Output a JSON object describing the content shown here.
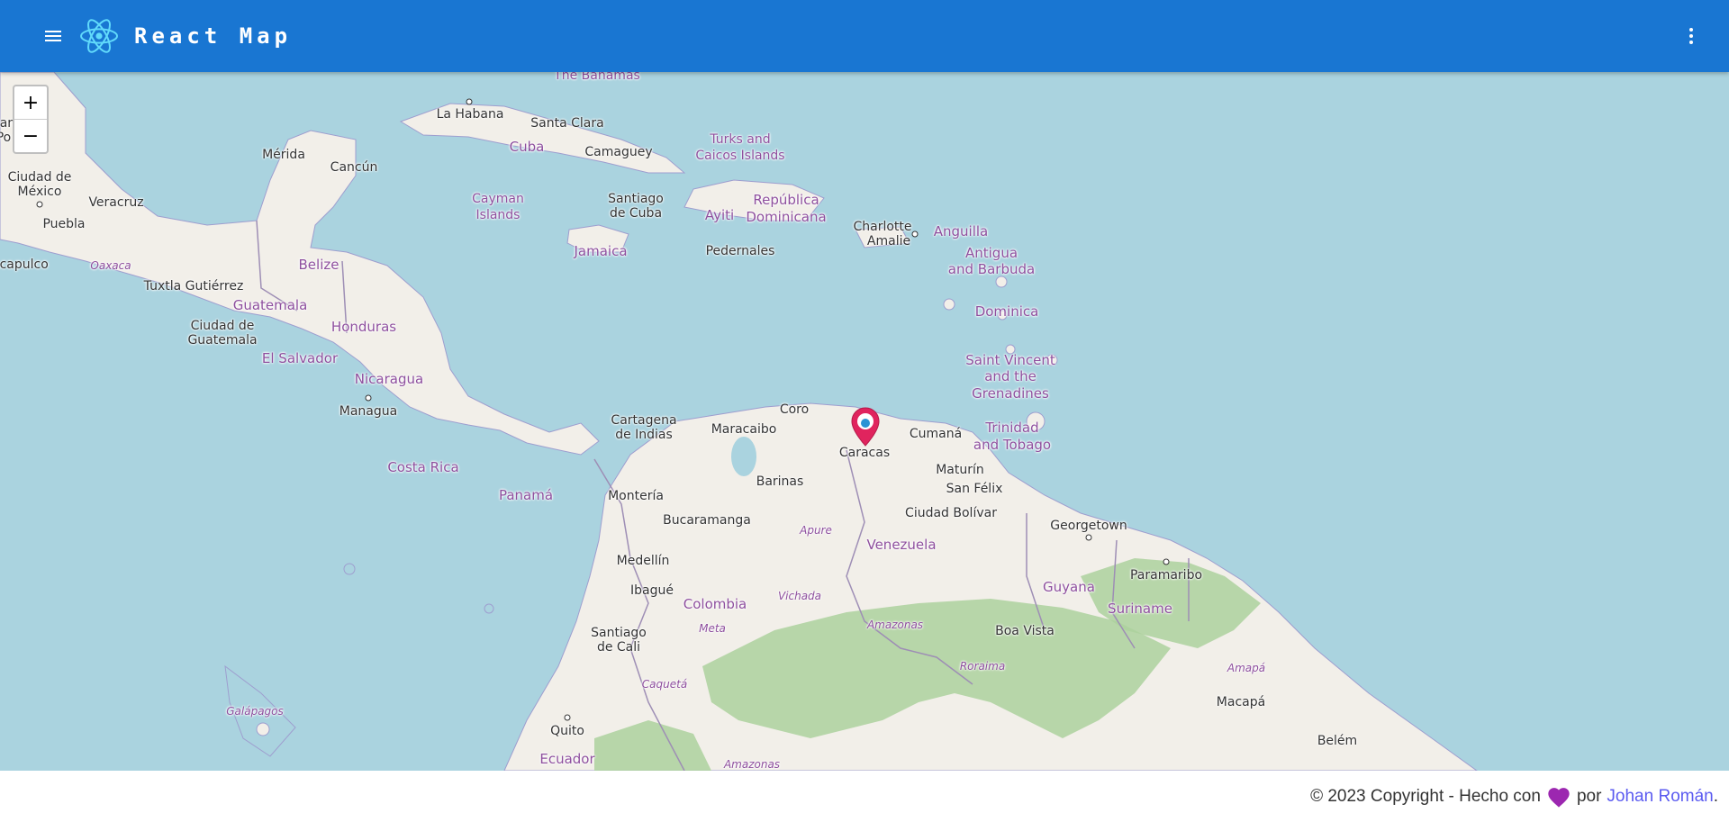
{
  "header": {
    "title": "React Map",
    "menu_icon": "menu-icon",
    "logo_icon": "react-atom-icon",
    "more_icon": "more-vert-icon",
    "background_color": "#1976d2"
  },
  "map": {
    "zoom_in": "+",
    "zoom_out": "−",
    "marker": "location-pin-icon",
    "marker_color": "#e0245e",
    "water_color": "#aad3df",
    "land_color": "#f2efe9",
    "forest_color": "#add19e",
    "labels": {
      "bahamas": "The Bahamas",
      "la_habana": "La Habana",
      "santa_clara": "Santa Clara",
      "cuba": "Cuba",
      "camaguey": "Camaguey",
      "turks_1": "Turks and",
      "turks_2": "Caicos Islands",
      "merida": "Mérida",
      "cancun": "Cancún",
      "cayman_1": "Cayman",
      "cayman_2": "Islands",
      "santiago_cuba_1": "Santiago",
      "santiago_cuba_2": "de Cuba",
      "ayiti": "Ayiti",
      "rep_dom_1": "República",
      "rep_dom_2": "Dominicana",
      "charlotte_1": "Charlotte",
      "charlotte_2": "Amalie",
      "anguilla": "Anguilla",
      "san_po_1": "San",
      "san_po_2": "Po",
      "ciudad_mexico_1": "Ciudad de",
      "ciudad_mexico_2": "México",
      "veracruz": "Veracruz",
      "puebla": "Puebla",
      "acapulco": "Acapulco",
      "oaxaca": "Oaxaca",
      "belize": "Belize",
      "jamaica": "Jamaica",
      "pedernales": "Pedernales",
      "antigua_1": "Antigua",
      "antigua_2": "and Barbuda",
      "tuxtla": "Tuxtla Gutiérrez",
      "guatemala": "Guatemala",
      "dominica": "Dominica",
      "ciudad_guatemala_1": "Ciudad de",
      "ciudad_guatemala_2": "Guatemala",
      "honduras": "Honduras",
      "el_salvador": "El Salvador",
      "saint_vincent_1": "Saint Vincent",
      "saint_vincent_2": "and the",
      "saint_vincent_3": "Grenadines",
      "nicaragua": "Nicaragua",
      "managua": "Managua",
      "cartagena_1": "Cartagena",
      "cartagena_2": "de Indias",
      "maracaibo": "Maracaibo",
      "coro": "Coro",
      "cumana": "Cumaná",
      "trinidad_1": "Trinidad",
      "trinidad_2": "and Tobago",
      "caracas": "Caracas",
      "costa_rica": "Costa Rica",
      "barinas": "Barinas",
      "maturin": "Maturín",
      "panama": "Panamá",
      "monteria": "Montería",
      "san_felix": "San Félix",
      "bucaramanga": "Bucaramanga",
      "ciudad_bolivar": "Ciudad Bolívar",
      "apure": "Apure",
      "georgetown": "Georgetown",
      "venezuela": "Venezuela",
      "medellin": "Medellín",
      "paramaribo": "Paramaribo",
      "guyana": "Guyana",
      "ibague": "Ibagué",
      "vichada": "Vichada",
      "colombia": "Colombia",
      "suriname": "Suriname",
      "amazonas_ve": "Amazonas",
      "meta": "Meta",
      "boa_vista": "Boa Vista",
      "santiago_cali_1": "Santiago",
      "santiago_cali_2": "de Cali",
      "roraima": "Roraima",
      "amapa": "Amapá",
      "caqueta": "Caquetá",
      "galapagos": "Galápagos",
      "macapa": "Macapá",
      "quito": "Quito",
      "belem": "Belém",
      "ecuador": "Ecuador",
      "amazonas_co": "Amazonas"
    }
  },
  "footer": {
    "copyright": "© 2023 Copyright - Hecho con",
    "heart_icon": "heart-icon",
    "heart_color": "#9c27b0",
    "por": "por",
    "author": "Johan Román",
    "period": "."
  }
}
